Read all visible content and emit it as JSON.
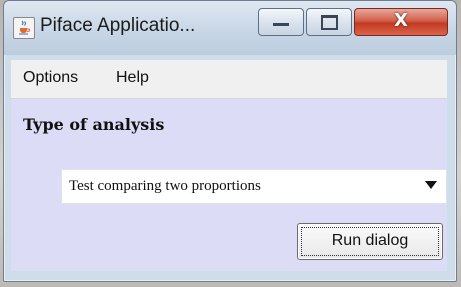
{
  "window": {
    "title": "Piface Applicatio...",
    "close_glyph": "X",
    "icon": "java-cup-icon"
  },
  "menubar": {
    "items": [
      {
        "label": "Options"
      },
      {
        "label": "Help"
      }
    ]
  },
  "main": {
    "heading": "Type of analysis",
    "analysis_select": {
      "selected": "Test comparing two proportions"
    },
    "run_button_label": "Run dialog"
  },
  "colors": {
    "content_bg": "#dcdcf6",
    "close_red": "#c23a22"
  }
}
